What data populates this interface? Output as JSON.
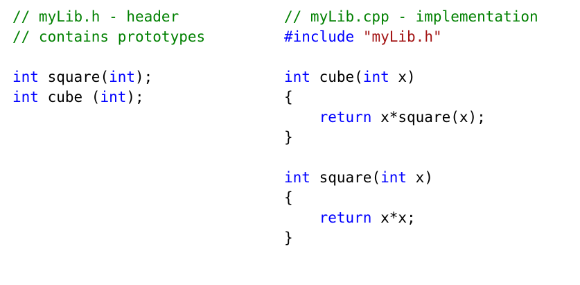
{
  "colors": {
    "comment": "#008000",
    "keyword": "#0000ff",
    "string": "#a31515",
    "text": "#000000",
    "background": "#ffffff"
  },
  "header_file": {
    "lines": [
      [
        {
          "t": "// myLib.h - header",
          "k": "comment"
        }
      ],
      [
        {
          "t": "// contains prototypes",
          "k": "comment"
        }
      ],
      [],
      [
        {
          "t": "int",
          "k": "keyword"
        },
        {
          "t": " square(",
          "k": "normal"
        },
        {
          "t": "int",
          "k": "keyword"
        },
        {
          "t": ");",
          "k": "normal"
        }
      ],
      [
        {
          "t": "int",
          "k": "keyword"
        },
        {
          "t": " cube (",
          "k": "normal"
        },
        {
          "t": "int",
          "k": "keyword"
        },
        {
          "t": ");",
          "k": "normal"
        }
      ]
    ]
  },
  "impl_file": {
    "lines": [
      [
        {
          "t": "// myLib.cpp - implementation",
          "k": "comment"
        }
      ],
      [
        {
          "t": "#include",
          "k": "keyword"
        },
        {
          "t": " ",
          "k": "normal"
        },
        {
          "t": "\"myLib.h\"",
          "k": "string"
        }
      ],
      [],
      [
        {
          "t": "int",
          "k": "keyword"
        },
        {
          "t": " cube(",
          "k": "normal"
        },
        {
          "t": "int",
          "k": "keyword"
        },
        {
          "t": " x)",
          "k": "normal"
        }
      ],
      [
        {
          "t": "{",
          "k": "normal"
        }
      ],
      [
        {
          "t": "    ",
          "k": "normal"
        },
        {
          "t": "return",
          "k": "keyword"
        },
        {
          "t": " x*square(x);",
          "k": "normal"
        }
      ],
      [
        {
          "t": "}",
          "k": "normal"
        }
      ],
      [],
      [
        {
          "t": "int",
          "k": "keyword"
        },
        {
          "t": " square(",
          "k": "normal"
        },
        {
          "t": "int",
          "k": "keyword"
        },
        {
          "t": " x)",
          "k": "normal"
        }
      ],
      [
        {
          "t": "{",
          "k": "normal"
        }
      ],
      [
        {
          "t": "    ",
          "k": "normal"
        },
        {
          "t": "return",
          "k": "keyword"
        },
        {
          "t": " x*x;",
          "k": "normal"
        }
      ],
      [
        {
          "t": "}",
          "k": "normal"
        }
      ]
    ]
  }
}
